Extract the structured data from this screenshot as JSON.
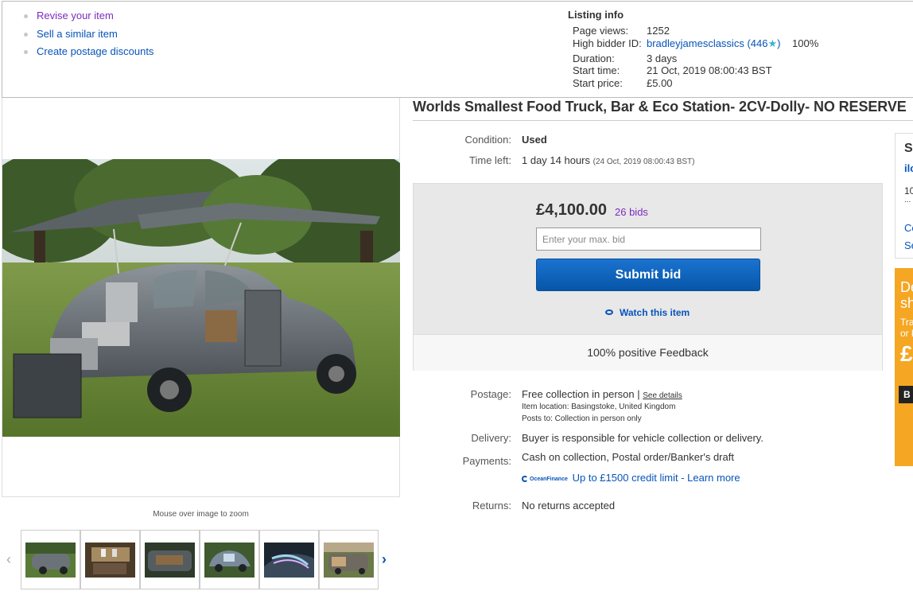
{
  "seller_links": [
    {
      "label": "Revise your item",
      "visited": true
    },
    {
      "label": "Sell a similar item",
      "visited": false
    },
    {
      "label": "Create postage discounts",
      "visited": false
    }
  ],
  "listing_info": {
    "title": "Listing info",
    "page_views_label": "Page views:",
    "page_views": "1252",
    "high_bidder_label": "High bidder ID:",
    "high_bidder": "bradleyjamesclassics",
    "bidder_feedback_score": "446",
    "bidder_positive_pct": "100%",
    "duration_label": "Duration:",
    "duration": "3 days",
    "start_time_label": "Start time:",
    "start_time": "21 Oct, 2019 08:00:43 BST",
    "start_price_label": "Start price:",
    "start_price": "£5.00"
  },
  "item": {
    "title": "Worlds Smallest Food Truck, Bar & Eco Station- 2CV-Dolly- NO RESERVE",
    "condition_label": "Condition:",
    "condition": "Used",
    "time_left_label": "Time left:",
    "time_left": "1 day 14 hours",
    "end_time": "(24 Oct, 2019  08:00:43 BST)"
  },
  "gallery": {
    "zoom_hint": "Mouse over image to zoom",
    "thumbnail_count": 6
  },
  "bid": {
    "price": "£4,100.00",
    "bids": "26 bids",
    "max_bid_placeholder": "Enter your max. bid",
    "submit_label": "Submit bid",
    "watch_label": "Watch this item",
    "feedback": "100% positive Feedback"
  },
  "postage": {
    "label": "Postage:",
    "value": "Free collection in person",
    "see_details": "See details",
    "location": "Item location:  Basingstoke, United Kingdom",
    "posts_to": "Posts to:  Collection in person only"
  },
  "delivery": {
    "label": "Delivery:",
    "value": "Buyer is responsible for vehicle collection or delivery."
  },
  "payments": {
    "label": "Payments:",
    "value": "Cash on collection,  Postal order/Banker's draft",
    "finance_logo": "OceanFinance",
    "credit": "Up to £1500 credit limit - Learn more"
  },
  "returns": {
    "label": "Returns:",
    "value": "No returns accepted"
  },
  "side_panel": {
    "heading": "S",
    "link": "ilc",
    "text1": "10",
    "text2": "...",
    "link2": "Co",
    "link3": "Se"
  },
  "ad_panel": {
    "line1": "De",
    "line2": "sh",
    "line3": "Tra",
    "line4": "or l",
    "big": "£",
    "button": "B"
  },
  "colors": {
    "link": "#0654ba",
    "visited": "#7b2cbf",
    "button": "#0756a8",
    "ad": "#f5a623"
  }
}
